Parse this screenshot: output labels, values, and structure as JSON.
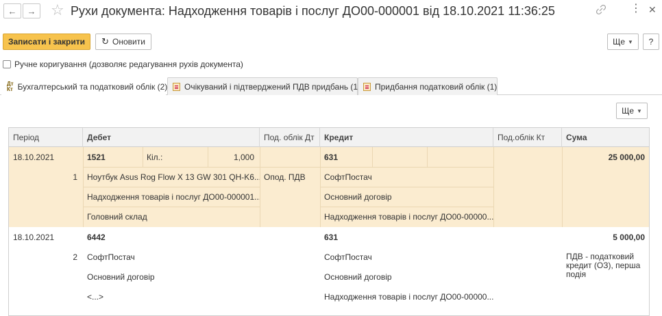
{
  "window": {
    "title": "Рухи документа: Надходження товарів і послуг ДО00-000001 від 18.10.2021 11:36:25"
  },
  "toolbar": {
    "save_close_label": "Записати і закрити",
    "refresh_label": "Оновити",
    "more_label": "Ще",
    "help_label": "?"
  },
  "manual_correction": {
    "label": "Ручне коригування (дозволяє редагування рухів документа)",
    "checked": false
  },
  "tabs": [
    {
      "label": "Бухгалтерський та податковий облік (2)",
      "active": true,
      "icon": "dt-kt-icon"
    },
    {
      "label": "Очікуваний і підтверджений ПДВ придбань (1)",
      "active": false,
      "icon": "register-icon"
    },
    {
      "label": "Придбання податковий облік (1)",
      "active": false,
      "icon": "register-icon"
    }
  ],
  "table_more_label": "Ще",
  "table": {
    "columns": [
      "Період",
      "Дебет",
      "Под. облік Дт",
      "Кредит",
      "Под.облік Кт",
      "Сума"
    ],
    "records": [
      {
        "period": "18.10.2021",
        "line_no": "1",
        "debit_account": "1521",
        "qty_label": "Кіл.:",
        "qty_value": "1,000",
        "debit_subconto": [
          "Ноутбук Asus Rog Flow X 13 GW 301 QH-K6...",
          "Надходження товарів і послуг ДО00-000001...",
          "Головний склад"
        ],
        "tax_dt": "Опод. ПДВ",
        "credit_account": "631",
        "credit_subconto": [
          "СофтПостач",
          "Основний договір",
          "Надходження товарів і послуг ДО00-00000..."
        ],
        "sum": "25 000,00",
        "sum_note": ""
      },
      {
        "period": "18.10.2021",
        "line_no": "2",
        "debit_account": "6442",
        "debit_subconto": [
          "СофтПостач",
          "Основний договір",
          "<...>"
        ],
        "tax_dt": "",
        "credit_account": "631",
        "credit_subconto": [
          "СофтПостач",
          "Основний договір",
          "Надходження товарів і послуг ДО00-00000..."
        ],
        "sum": "5 000,00",
        "sum_note": "ПДВ - податковий кредит (ОЗ), перша подія"
      }
    ]
  },
  "colors": {
    "primary_button": "#f7c34d",
    "selected_row": "#fbecd0",
    "header_bg": "#f2f2f2"
  }
}
